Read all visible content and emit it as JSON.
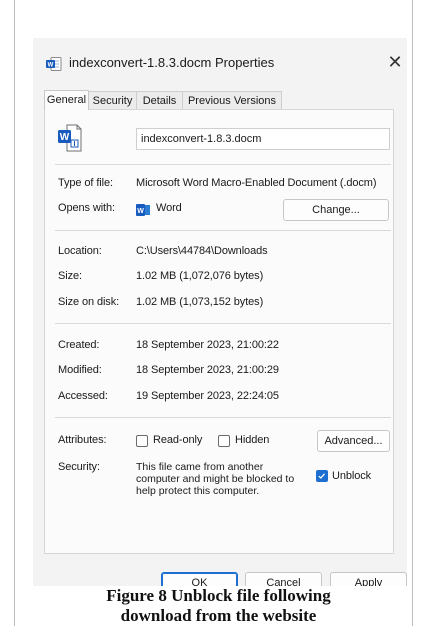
{
  "window": {
    "title": "indexconvert-1.8.3.docm Properties",
    "close_glyph": "✕"
  },
  "tabs": [
    {
      "label": "General",
      "active": true
    },
    {
      "label": "Security",
      "active": false
    },
    {
      "label": "Details",
      "active": false
    },
    {
      "label": "Previous Versions",
      "active": false
    }
  ],
  "file": {
    "name": "indexconvert-1.8.3.docm",
    "icon": "word-document-icon"
  },
  "info": {
    "type_label": "Type of file:",
    "type_value": "Microsoft Word Macro-Enabled Document (.docm)",
    "opens_label": "Opens with:",
    "opens_value": "Word",
    "change_label": "Change...",
    "location_label": "Location:",
    "location_value": "C:\\Users\\44784\\Downloads",
    "size_label": "Size:",
    "size_value": "1.02 MB (1,072,076 bytes)",
    "disk_label": "Size on disk:",
    "disk_value": "1.02 MB (1,073,152 bytes)",
    "created_label": "Created:",
    "created_value": "18 September 2023, 21:00:22",
    "modified_label": "Modified:",
    "modified_value": "18 September 2023, 21:00:29",
    "accessed_label": "Accessed:",
    "accessed_value": "19 September 2023, 22:24:05"
  },
  "attributes": {
    "label": "Attributes:",
    "readonly_label": "Read-only",
    "readonly_checked": false,
    "hidden_label": "Hidden",
    "hidden_checked": false,
    "advanced_label": "Advanced..."
  },
  "security": {
    "label": "Security:",
    "message_line1": "This file came from another",
    "message_line2": "computer and might be blocked to",
    "message_line3": "help protect this computer.",
    "unblock_label": "Unblock",
    "unblock_checked": true
  },
  "buttons": {
    "ok": "OK",
    "cancel": "Cancel",
    "apply": "Apply"
  },
  "colors": {
    "accent": "#1f6fd1",
    "word_blue": "#185abd"
  },
  "caption": {
    "line1": "Figure 8 Unblock file following",
    "line2": "download from the website"
  }
}
